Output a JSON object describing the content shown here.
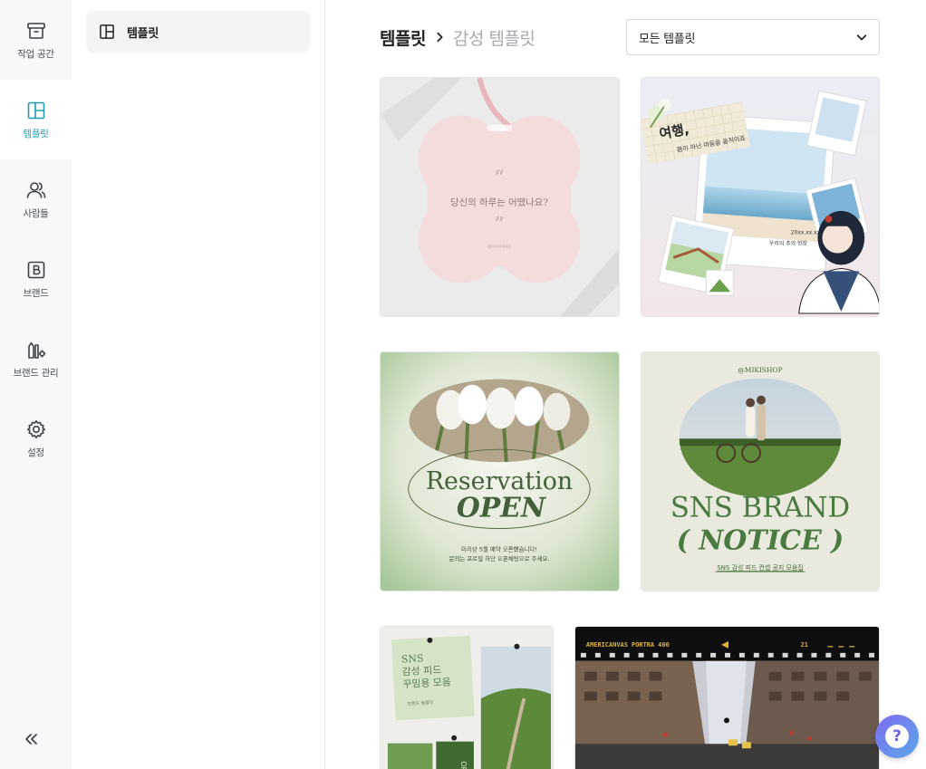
{
  "rail": {
    "items": [
      {
        "label": "작업 공간",
        "icon": "archive-box-icon",
        "active": false
      },
      {
        "label": "템플릿",
        "icon": "layout-template-icon",
        "active": true
      },
      {
        "label": "사람들",
        "icon": "people-icon",
        "active": false
      },
      {
        "label": "브랜드",
        "icon": "brand-b-icon",
        "active": false
      },
      {
        "label": "브랜드 관리",
        "icon": "brand-manage-icon",
        "active": false
      },
      {
        "label": "설정",
        "icon": "gear-icon",
        "active": false
      }
    ],
    "collapse_icon": "double-chevron-left-icon"
  },
  "subpanel": {
    "item_label": "템플릿",
    "item_icon": "layout-template-icon"
  },
  "main": {
    "breadcrumb": {
      "root": "템플릿",
      "current": "감성 템플릿"
    },
    "filter": {
      "selected": "모든 템플릿"
    },
    "cards": [
      {
        "name": "flower-quote-card",
        "text": "당신의 하루는 어땠나요?",
        "handle": "@kaiiilaaa"
      },
      {
        "name": "travel-collage-card",
        "title": "여행,",
        "subtitle": "몸이 아닌 마음을 움직이죠",
        "date": "20xx.xx.xx",
        "caption": "우리의 추억 한장"
      },
      {
        "name": "reservation-open-card",
        "title": "Reservation",
        "emphasis": "OPEN",
        "line1": "미리상 5월 예약 오픈했습니다!",
        "line2": "문의는 프로필 하단 오픈채팅으로 주세요."
      },
      {
        "name": "sns-brand-notice-card",
        "handle": "@MIKISHOP",
        "title": "SNS BRAND",
        "emphasis": "( NOTICE )",
        "caption": "SNS 감성 피드 컨셉 공지 모음집"
      },
      {
        "name": "sns-feed-card",
        "title_line1": "SNS",
        "title_line2": "감성 피드",
        "title_line3": "꾸밈용 모음",
        "caption": "브랜드 템플릿",
        "side": "OP"
      },
      {
        "name": "film-city-card",
        "film_label": "AMERICANVAS PORTRA 400",
        "frame": "21"
      }
    ]
  },
  "help": {
    "label": "?"
  },
  "colors": {
    "accent": "#1e9db0",
    "rail_bg": "#f7f8fa",
    "text_muted": "#a5a9b0"
  }
}
